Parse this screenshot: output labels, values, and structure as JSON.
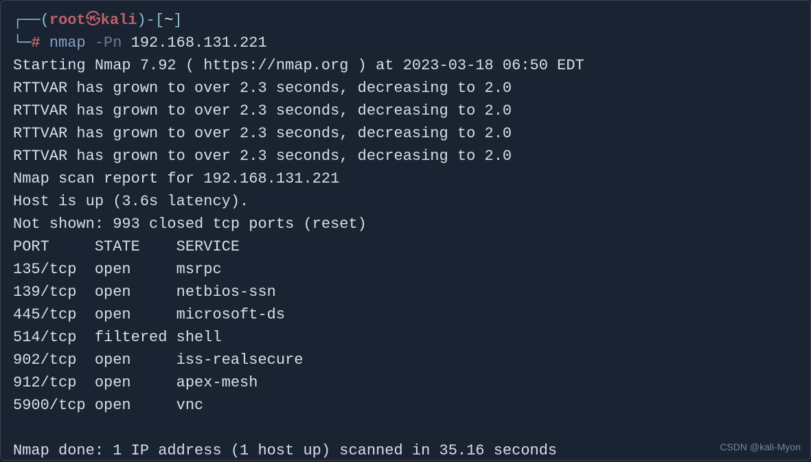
{
  "prompt": {
    "line1_prefix": "┌──",
    "paren_open": "(",
    "user": "root",
    "skull": "㉿",
    "host": "kali",
    "paren_close": ")",
    "dash": "-",
    "bracket_open": "[",
    "tilde": "~",
    "bracket_close": "]",
    "line2_prefix": "└─",
    "hash": "#",
    "command": " nmap",
    "flag": " -Pn",
    "arg": " 192.168.131.221"
  },
  "output": {
    "starting": "Starting Nmap 7.92 ( https://nmap.org ) at 2023-03-18 06:50 EDT",
    "rttvar1": "RTTVAR has grown to over 2.3 seconds, decreasing to 2.0",
    "rttvar2": "RTTVAR has grown to over 2.3 seconds, decreasing to 2.0",
    "rttvar3": "RTTVAR has grown to over 2.3 seconds, decreasing to 2.0",
    "rttvar4": "RTTVAR has grown to over 2.3 seconds, decreasing to 2.0",
    "report": "Nmap scan report for 192.168.131.221",
    "hostup": "Host is up (3.6s latency).",
    "notshown": "Not shown: 993 closed tcp ports (reset)",
    "header": "PORT     STATE    SERVICE",
    "rows": [
      "135/tcp  open     msrpc",
      "139/tcp  open     netbios-ssn",
      "445/tcp  open     microsoft-ds",
      "514/tcp  filtered shell",
      "902/tcp  open     iss-realsecure",
      "912/tcp  open     apex-mesh",
      "5900/tcp open     vnc"
    ],
    "blank": " ",
    "done": "Nmap done: 1 IP address (1 host up) scanned in 35.16 seconds"
  },
  "watermark": "CSDN @kali-Myon"
}
